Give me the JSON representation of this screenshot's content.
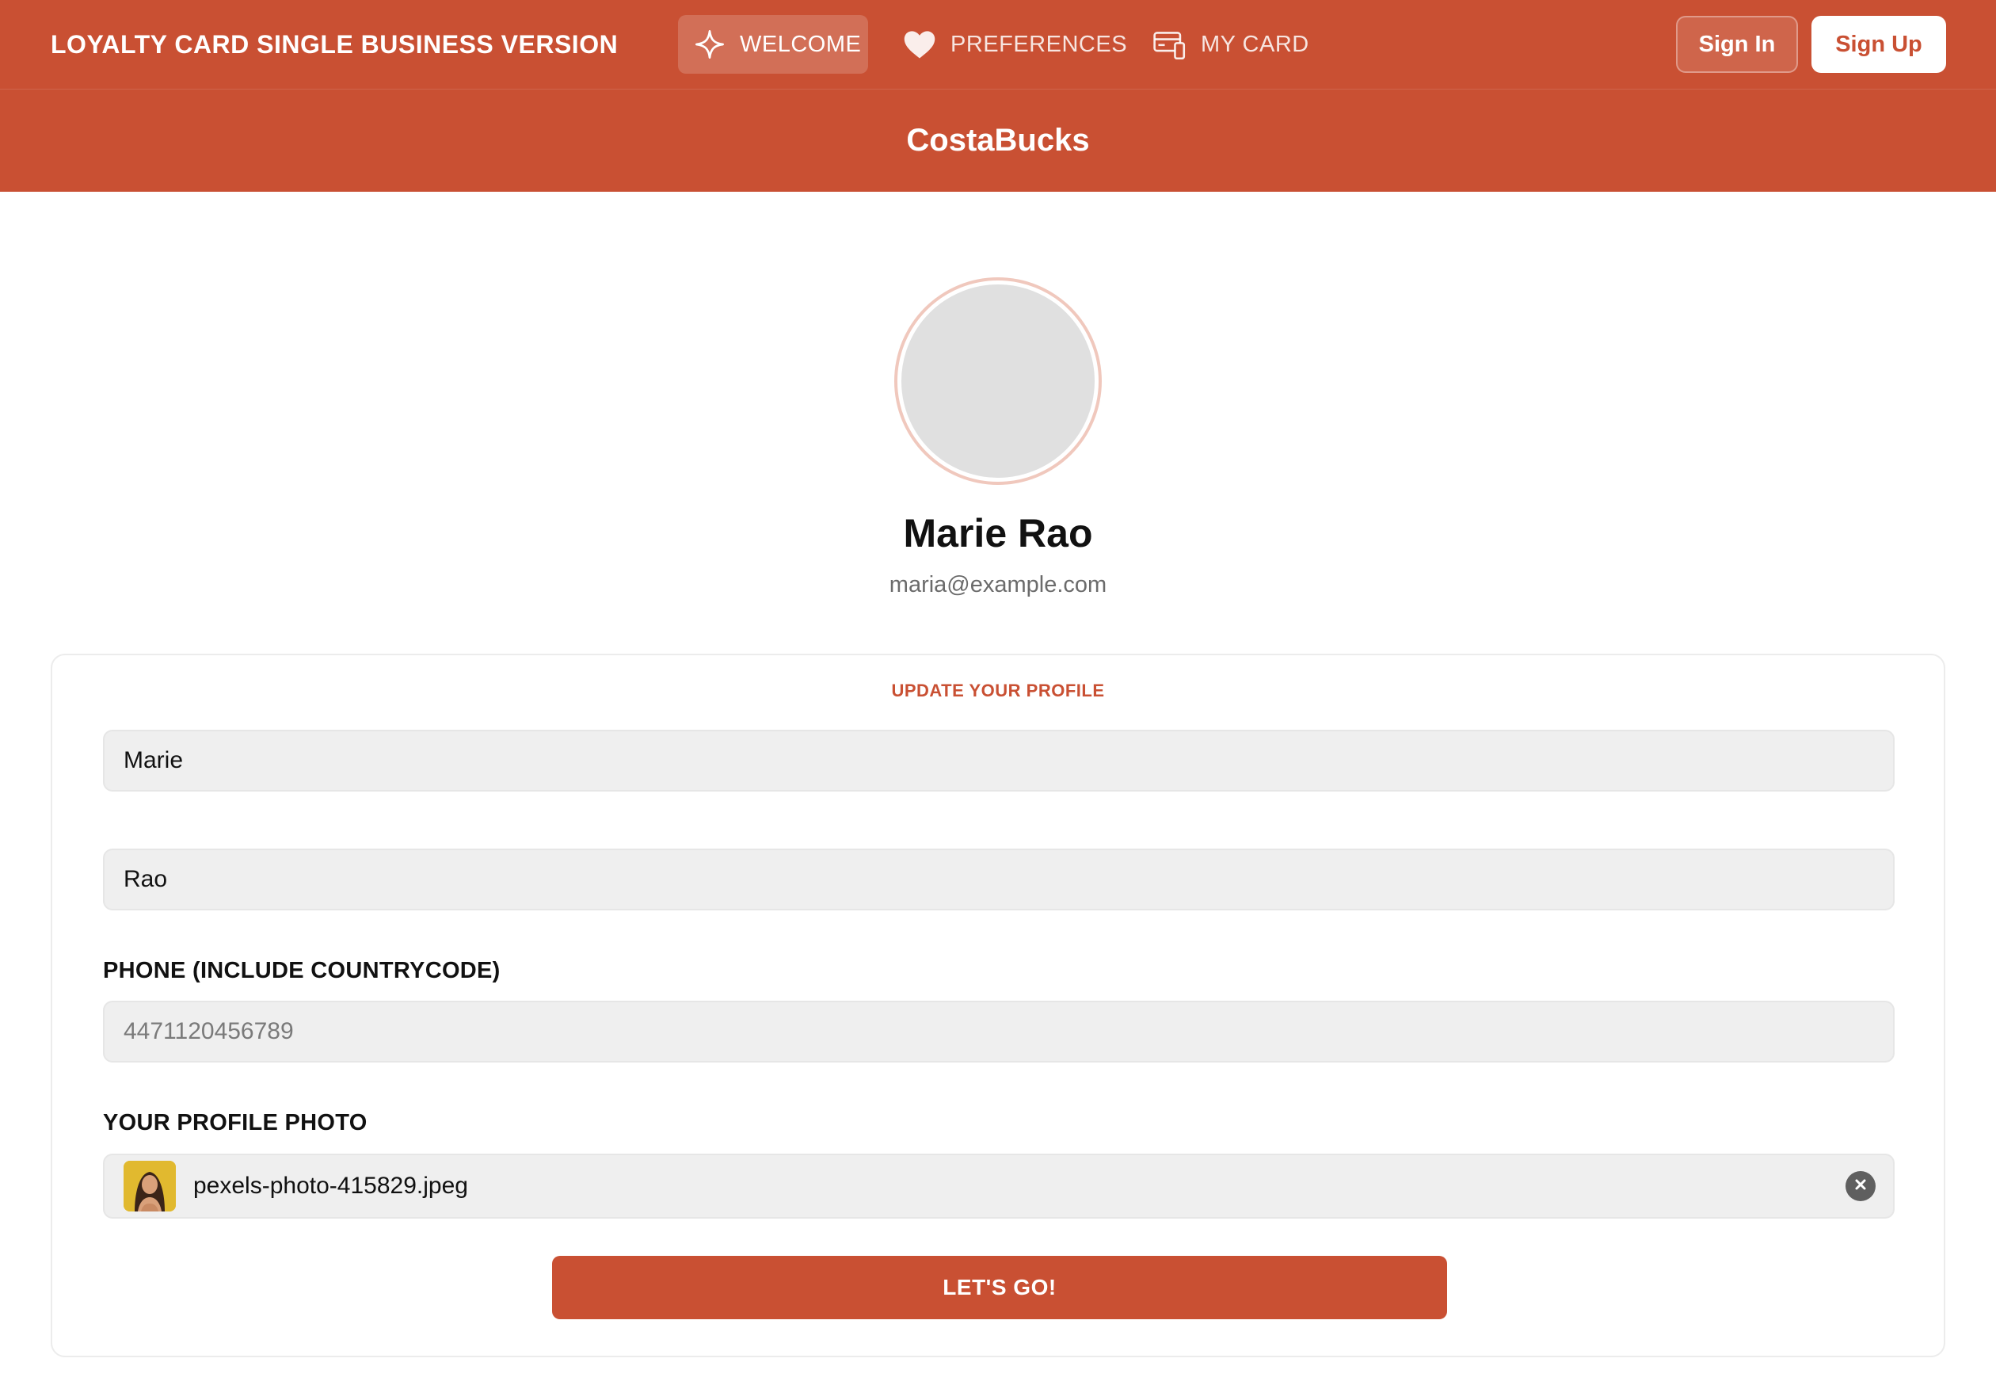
{
  "navbar": {
    "brand": "LOYALTY CARD SINGLE BUSINESS VERSION",
    "items": [
      {
        "label": "WELCOME",
        "icon": "sparkle-icon",
        "active": true
      },
      {
        "label": "PREFERENCES",
        "icon": "heart-icon",
        "active": false
      },
      {
        "label": "MY CARD",
        "icon": "card-device-icon",
        "active": false
      }
    ],
    "sign_in": "Sign In",
    "sign_up": "Sign Up"
  },
  "business": {
    "name": "CostaBucks"
  },
  "profile": {
    "name": "Marie Rao",
    "email": "maria@example.com"
  },
  "form": {
    "heading": "UPDATE YOUR PROFILE",
    "first_name": "Marie",
    "last_name": "Rao",
    "phone_label": "PHONE (INCLUDE COUNTRYCODE)",
    "phone_placeholder": "4471120456789",
    "photo_label": "YOUR PROFILE PHOTO",
    "photo_file": "pexels-photo-415829.jpeg",
    "submit": "LET'S GO!"
  },
  "colors": {
    "accent": "#c95033",
    "field_bg": "#efefef",
    "avatar_bg": "#e0e0e0"
  }
}
